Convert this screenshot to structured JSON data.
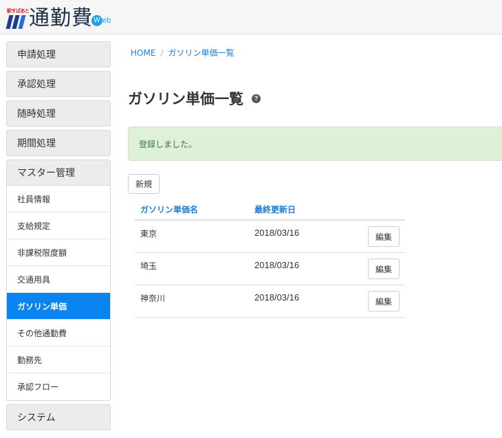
{
  "header": {
    "logo_tag": "駅すぱあと",
    "logo_text": "通勤費",
    "logo_web_initial": "W",
    "logo_web_rest": "eb"
  },
  "sidebar": {
    "groups": [
      {
        "label": "申請処理"
      },
      {
        "label": "承認処理"
      },
      {
        "label": "随時処理"
      },
      {
        "label": "期間処理"
      }
    ],
    "master": {
      "label": "マスター管理",
      "items": [
        {
          "label": "社員情報"
        },
        {
          "label": "支給規定"
        },
        {
          "label": "非課税限度額"
        },
        {
          "label": "交通用具"
        },
        {
          "label": "ガソリン単価",
          "active": true
        },
        {
          "label": "その他通勤費"
        },
        {
          "label": "勤務先"
        },
        {
          "label": "承認フロー"
        }
      ]
    },
    "system": {
      "label": "システム"
    }
  },
  "breadcrumb": {
    "home": "HOME",
    "separator": "/",
    "current": "ガソリン単価一覧"
  },
  "page": {
    "title": "ガソリン単価一覧",
    "help_icon_glyph": "?",
    "alert": "登録しました。",
    "new_button": "新規"
  },
  "table": {
    "headers": [
      "ガソリン単価名",
      "最終更新日"
    ],
    "rows": [
      {
        "name": "東京",
        "updated": "2018/03/16",
        "action": "編集"
      },
      {
        "name": "埼玉",
        "updated": "2018/03/16",
        "action": "編集"
      },
      {
        "name": "神奈川",
        "updated": "2018/03/16",
        "action": "編集"
      }
    ]
  },
  "colors": {
    "accent": "#0a84f0",
    "link": "#1e7bd6",
    "alert_bg": "#dff0d8",
    "alert_text": "#3c763d",
    "logo_web": "#21a0e8"
  }
}
